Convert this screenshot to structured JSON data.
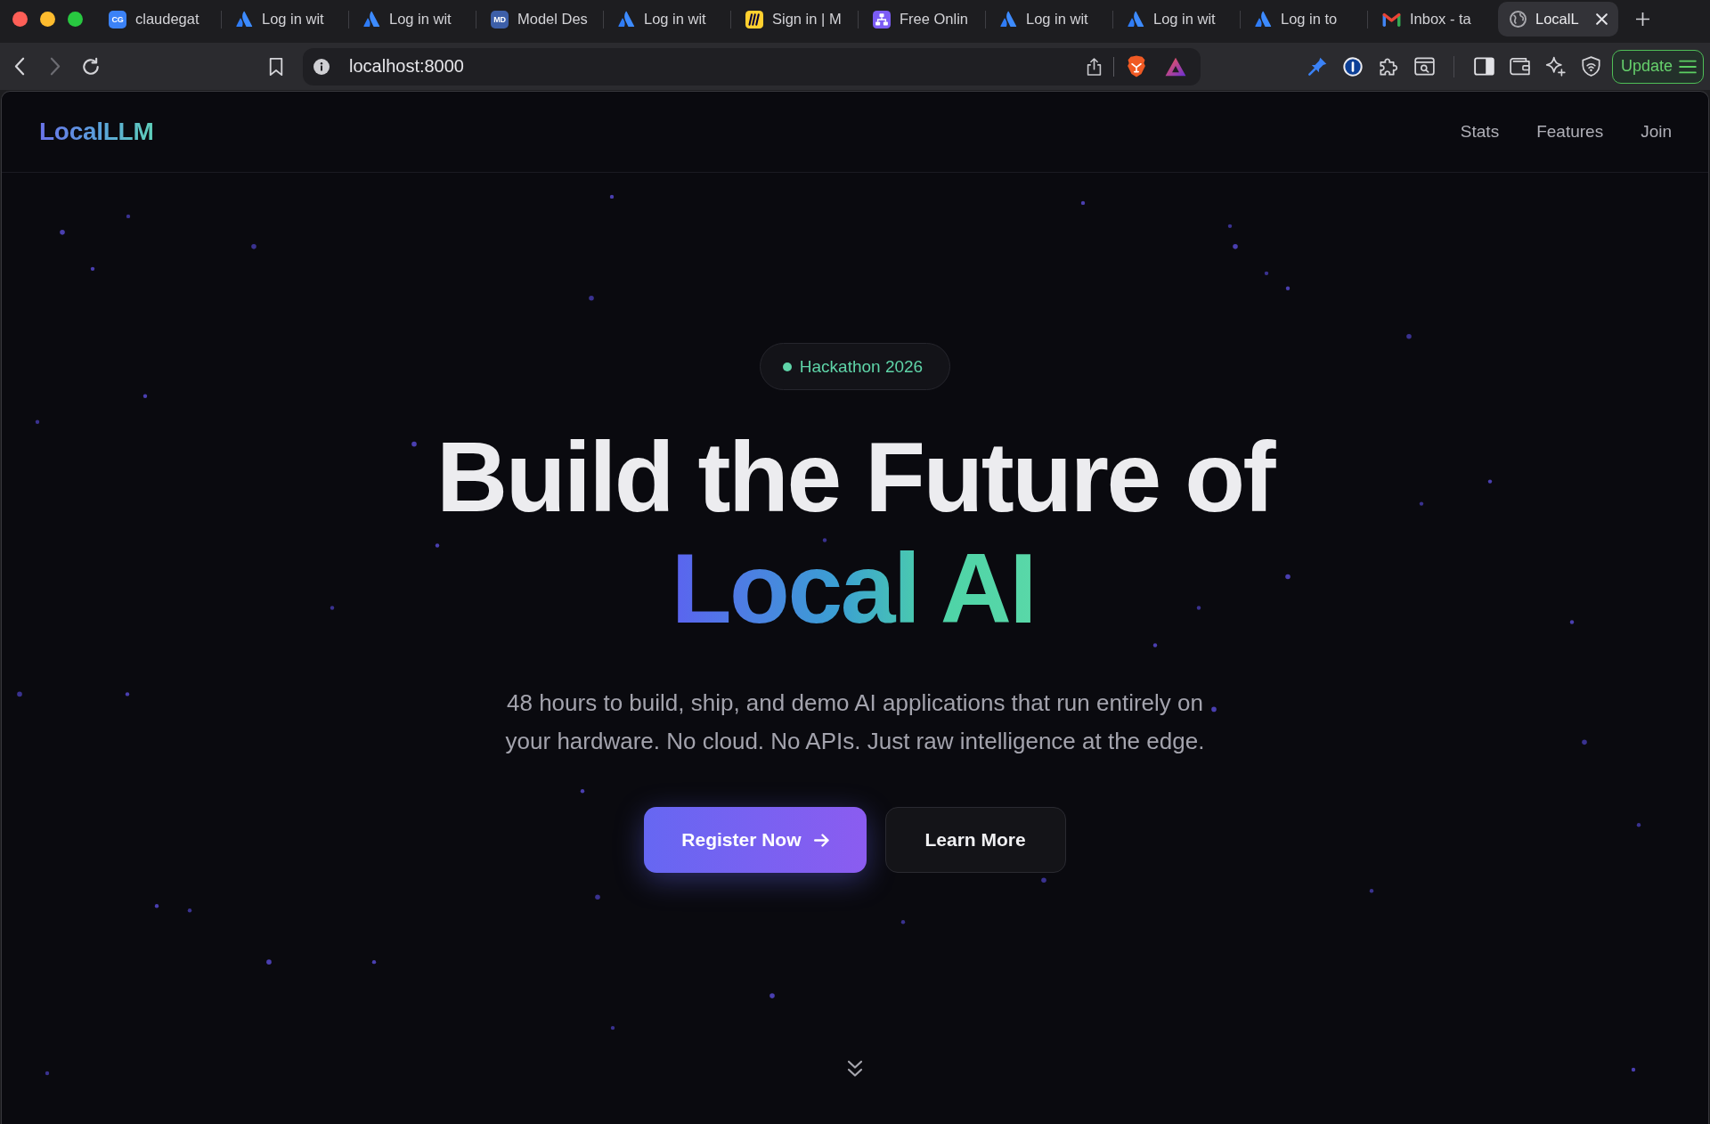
{
  "browser": {
    "tabs": [
      {
        "kind": "letters",
        "favicon_text": "CG",
        "color": "#3b82f6",
        "title": "claudegat",
        "selected": false
      },
      {
        "kind": "triangle",
        "title": "Log in wit",
        "selected": false
      },
      {
        "kind": "triangle",
        "title": "Log in wit",
        "selected": false
      },
      {
        "kind": "letters",
        "favicon_text": "MD",
        "color": "#3d5fa8",
        "title": "Model Des",
        "selected": false
      },
      {
        "kind": "triangle",
        "title": "Log in wit",
        "selected": false
      },
      {
        "kind": "stripes",
        "title": "Sign in | M",
        "selected": false
      },
      {
        "kind": "diagram",
        "title": "Free Onlin",
        "selected": false
      },
      {
        "kind": "triangle",
        "title": "Log in wit",
        "selected": false
      },
      {
        "kind": "triangle",
        "title": "Log in wit",
        "selected": false
      },
      {
        "kind": "triangle",
        "title": "Log in to",
        "selected": false
      },
      {
        "kind": "mail",
        "title": "Inbox - ta",
        "selected": false
      },
      {
        "kind": "globe",
        "title": "LocalL",
        "selected": true
      }
    ],
    "nav_buttons": [
      {
        "kind": "back",
        "disabled": false
      },
      {
        "kind": "forward",
        "disabled": true
      },
      {
        "kind": "reload",
        "disabled": false
      }
    ],
    "url": "localhost:8000",
    "update_button": "Update"
  },
  "site_nav": {
    "logo": "LocalLLM",
    "links": [
      "Stats",
      "Features",
      "Join"
    ]
  },
  "hero": {
    "badge": "Hackathon 2026",
    "heading": "Build the Future of",
    "heading_highlight": "Local AI",
    "description": "48 hours to build, ship, and demo AI applications that run entirely on your hardware. No cloud. No APIs. Just raw intelligence at the edge.",
    "buttons": [
      {
        "kind": "primary",
        "label": "Register Now"
      },
      {
        "kind": "secondary",
        "label": "Learn More"
      }
    ]
  }
}
